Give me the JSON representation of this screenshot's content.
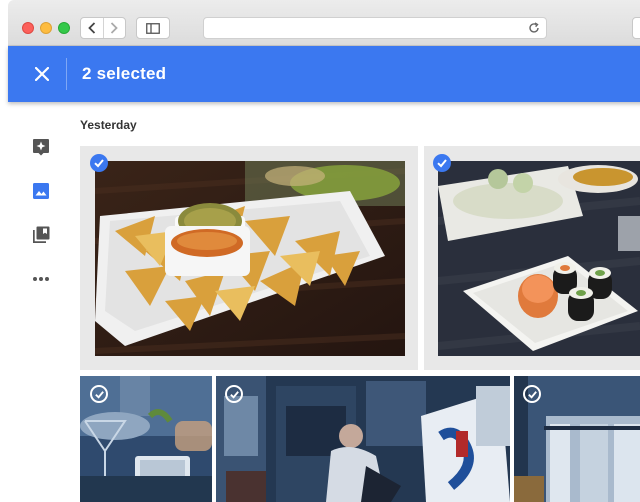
{
  "browser": {
    "traffic_lights": [
      "close",
      "minimize",
      "zoom"
    ],
    "url": ""
  },
  "appbar": {
    "selected_label": "2 selected",
    "color": "#3b78f0"
  },
  "rail": {
    "items": [
      {
        "name": "assistant",
        "icon": "assistant-icon",
        "active": false
      },
      {
        "name": "photos",
        "icon": "photos-icon",
        "active": true
      },
      {
        "name": "albums",
        "icon": "albums-icon",
        "active": false
      },
      {
        "name": "more",
        "icon": "more-horiz-icon",
        "active": false
      }
    ]
  },
  "section": {
    "date_label": "Yesterday"
  },
  "photos": [
    {
      "subject": "nachos",
      "selected": true
    },
    {
      "subject": "sushi",
      "selected": true
    },
    {
      "subject": "drinks",
      "selected": false
    },
    {
      "subject": "painter-studio",
      "selected": false
    },
    {
      "subject": "window-room",
      "selected": false
    }
  ]
}
